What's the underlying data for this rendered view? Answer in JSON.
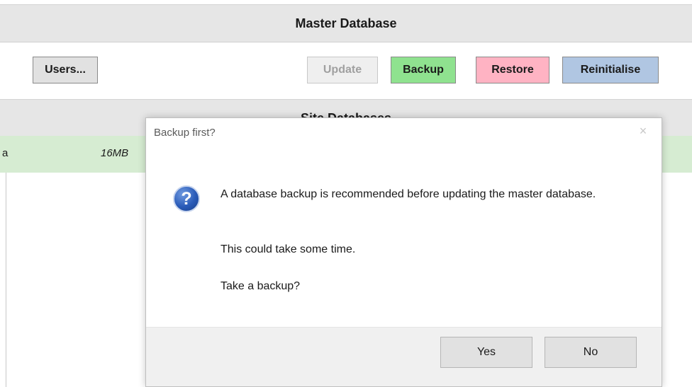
{
  "master": {
    "header": "Master Database",
    "buttons": {
      "users": "Users...",
      "update": "Update",
      "backup": "Backup",
      "restore": "Restore",
      "reinitialise": "Reinitialise"
    }
  },
  "sites": {
    "header": "Site Databases",
    "rows": [
      {
        "name_fragment": "a",
        "size": "16MB"
      }
    ]
  },
  "dialog": {
    "title": "Backup first?",
    "icon": "question-icon",
    "message_1": "A database backup is recommended before updating the master database.",
    "message_2": "This could take some time.",
    "message_3": "Take a backup?",
    "yes": "Yes",
    "no": "No",
    "close": "×"
  },
  "colors": {
    "backup": "#8fe28f",
    "restore": "#ffb3c3",
    "reinitialise": "#b0c6e2",
    "site_row": "#d6ecd2"
  }
}
